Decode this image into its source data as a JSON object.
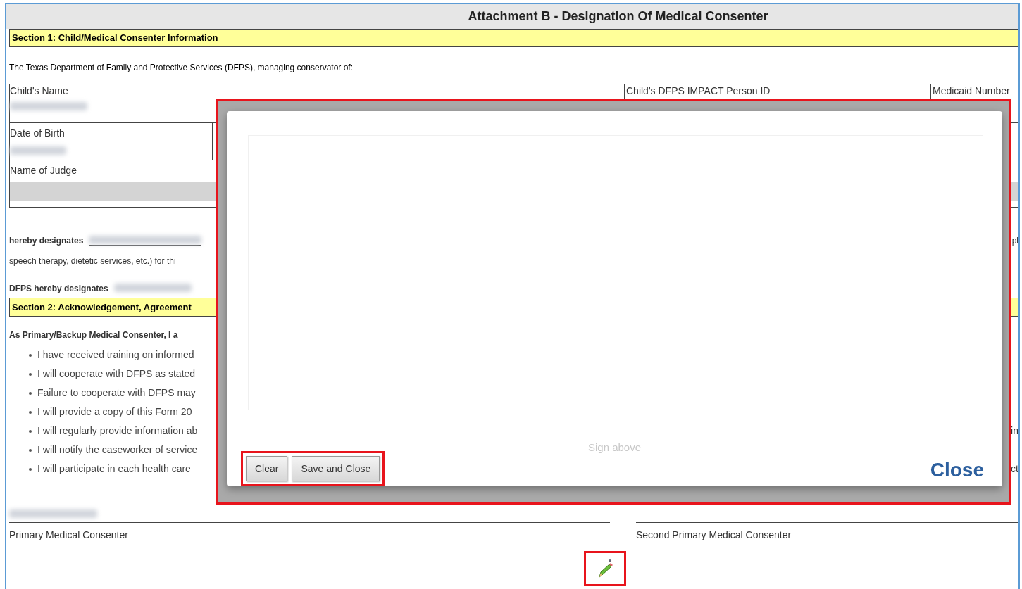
{
  "document": {
    "title": "Attachment B - Designation Of Medical Consenter"
  },
  "section_1": {
    "heading": "Section 1: Child/Medical Consenter Information",
    "intro": "The Texas Department of Family and Protective Services (DFPS), managing conservator of:",
    "row_1": [
      "Child's Name",
      "Child's DFPS IMPACT Person ID",
      "Medicaid Number"
    ],
    "row_2": [
      "Date of Birth"
    ],
    "row_3": [
      "Name of Judge"
    ],
    "designation_1": {
      "label": "hereby designates",
      "edge_text": "pl"
    },
    "designation_1_line_2": "speech therapy, dietetic services, etc.) for thi",
    "designation_2": {
      "label": "DFPS hereby designates"
    }
  },
  "section_2": {
    "heading": "Section 2: Acknowledgement, Agreement",
    "lead": "As Primary/Backup Medical Consenter, I a",
    "bullets": [
      {
        "text": "I have received training on informed"
      },
      {
        "text": "I will cooperate with DFPS as stated"
      },
      {
        "text": "Failure to cooperate with DFPS may"
      },
      {
        "text": "I will provide a copy of this Form 20"
      },
      {
        "text": "I will regularly provide information ab",
        "edge_text": "in"
      },
      {
        "text": "I will notify the caseworker of service"
      },
      {
        "text": "I will participate in each health care",
        "edge_text": "ct"
      }
    ]
  },
  "signatures": [
    {
      "label": "Primary Medical Consenter"
    },
    {
      "label": "Second Primary Medical Consenter"
    }
  ],
  "signature_dialog": {
    "hint": "Sign above",
    "buttons": [
      "Clear",
      "Save and Close"
    ],
    "close": "Close"
  }
}
